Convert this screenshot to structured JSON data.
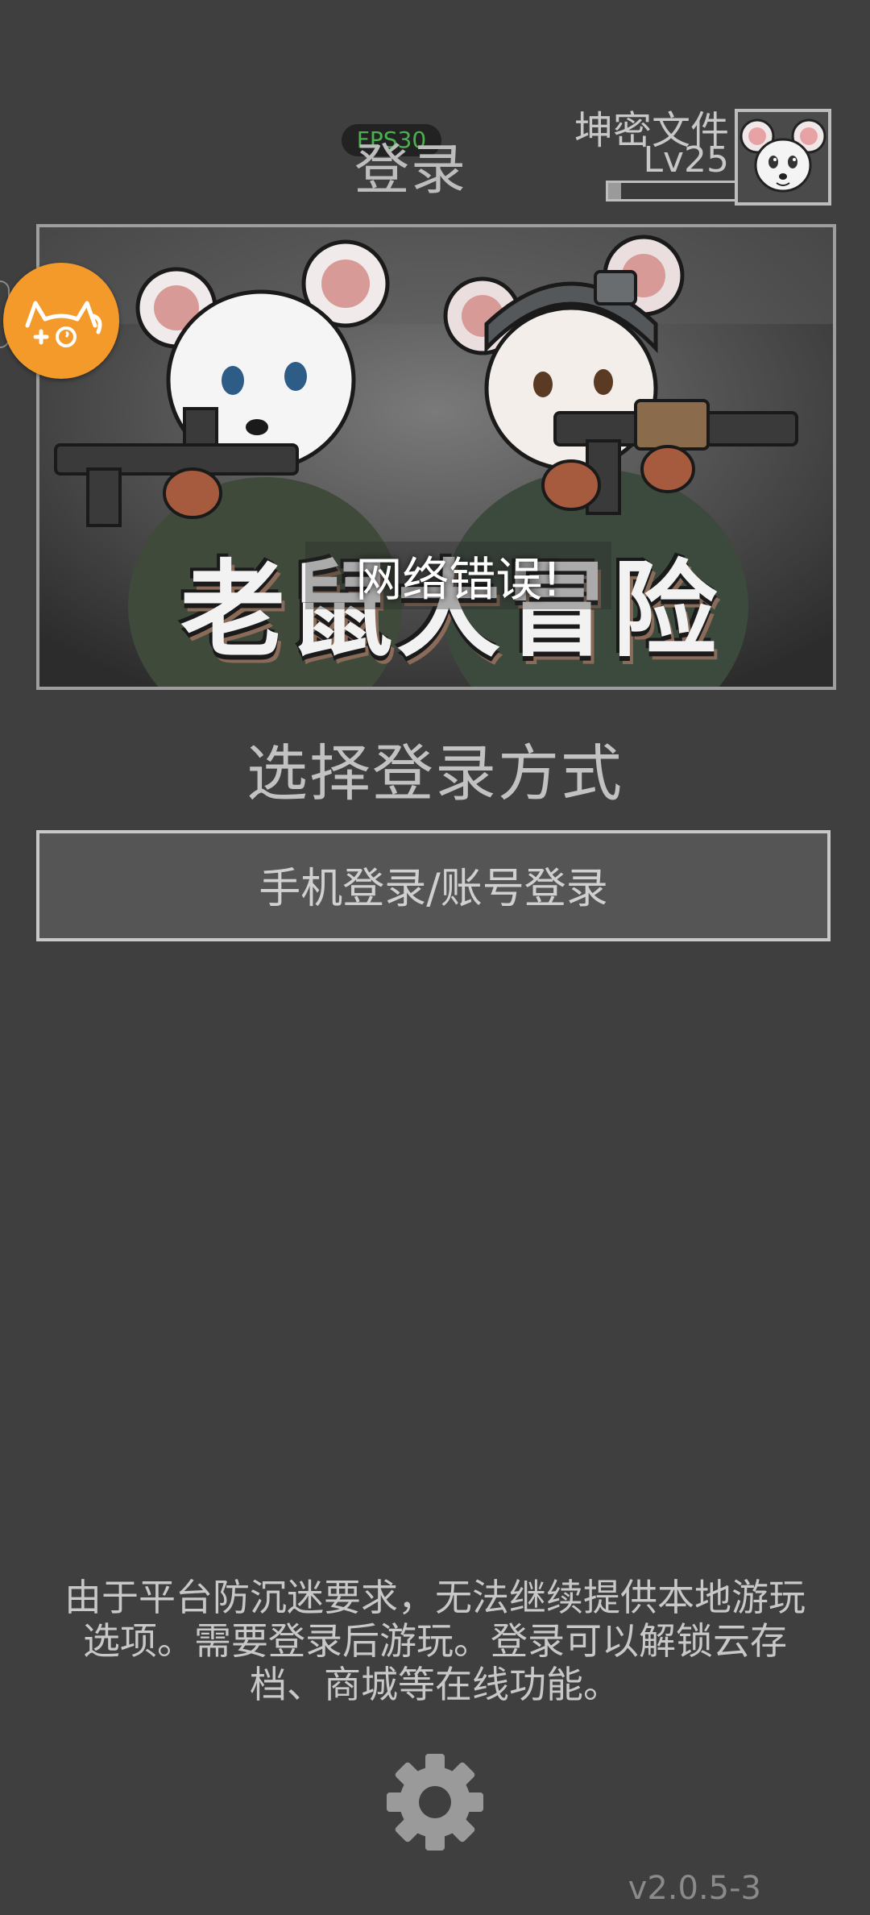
{
  "header": {
    "title": "登录",
    "fps": "FPS30",
    "user_name": "坤密文件",
    "user_level": "Lv25",
    "xp_progress": 0.1
  },
  "banner": {
    "game_title": "老鼠大冒险",
    "error_message": "网络错误!"
  },
  "login": {
    "section_title": "选择登录方式",
    "phone_account_button": "手机登录/账号登录"
  },
  "footer": {
    "notice": "由于平台防沉迷要求，无法继续提供本地游玩选项。需要登录后游玩。登录可以解锁云存档、商城等在线功能。",
    "version": "v2.0.5-3"
  },
  "icons": {
    "assistant": "cat-assistant-icon",
    "settings": "gear-icon",
    "avatar": "mouse-avatar"
  },
  "colors": {
    "background": "#3f3f3f",
    "assistant_orange": "#f39a2a",
    "fps_green": "#4caf50",
    "button_fill": "#555555"
  }
}
